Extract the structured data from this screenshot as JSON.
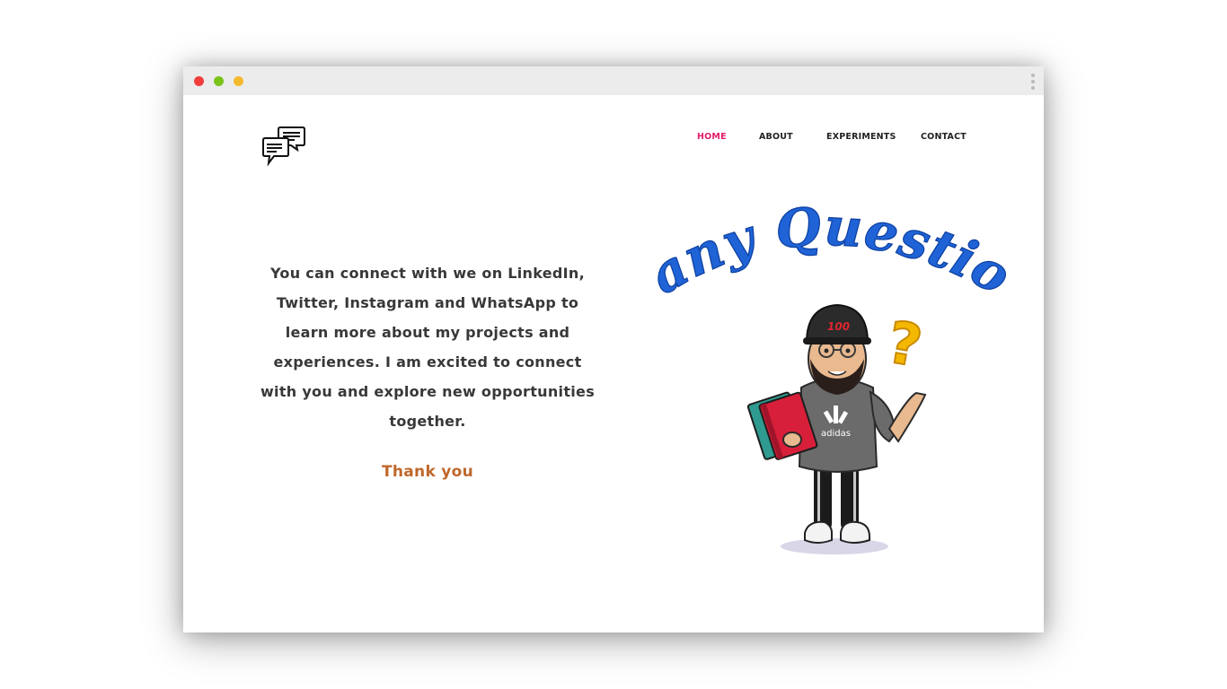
{
  "nav": {
    "items": [
      {
        "label": "HOME",
        "active": true
      },
      {
        "label": "ABOUT",
        "active": false
      },
      {
        "label": "EXPERIMENTS",
        "active": false
      },
      {
        "label": "CONTACT",
        "active": false
      }
    ]
  },
  "main": {
    "message": "You can connect with we on LinkedIn, Twitter, Instagram and WhatsApp to learn more about my projects and experiences. I am excited to connect with you and explore new opportunities together.",
    "thanks": "Thank you"
  },
  "illustration": {
    "heading": "any Questions?",
    "cap_badge": "100",
    "hoodie_brand": "adidas"
  },
  "colors": {
    "accent_nav": "#e11d6b",
    "thanks": "#c0672b",
    "heading_blue": "#1f63d6",
    "question_mark": "#f5b800",
    "book_red": "#d81f3a",
    "traffic_red": "#f23d3d",
    "traffic_green": "#7ac41a",
    "traffic_yellow": "#f5b92e"
  },
  "icons": {
    "logo": "chat-bubbles-icon"
  }
}
